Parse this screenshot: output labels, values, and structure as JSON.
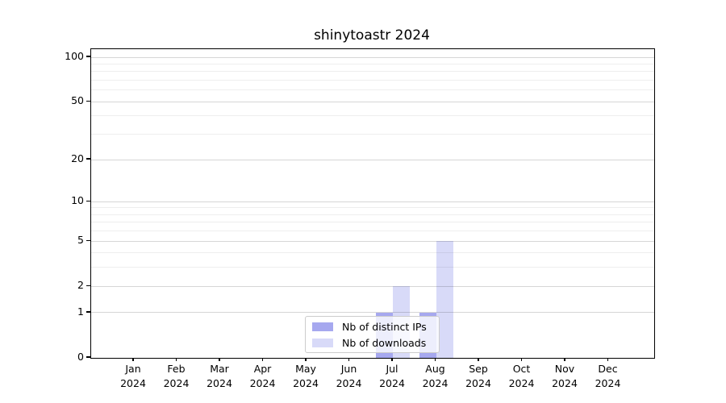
{
  "chart_data": {
    "type": "bar",
    "title": "shinytoastr 2024",
    "categories": [
      "Jan",
      "Feb",
      "Mar",
      "Apr",
      "May",
      "Jun",
      "Jul",
      "Aug",
      "Sep",
      "Oct",
      "Nov",
      "Dec"
    ],
    "year_label": "2024",
    "series": [
      {
        "name": "Nb of distinct IPs",
        "color": "#a6a8ef",
        "values": [
          0,
          0,
          0,
          0,
          0,
          0,
          1,
          1,
          0,
          0,
          0,
          0
        ]
      },
      {
        "name": "Nb of downloads",
        "color": "#d8daf8",
        "values": [
          0,
          0,
          0,
          0,
          0,
          0,
          2,
          5,
          0,
          0,
          0,
          0
        ]
      }
    ],
    "xlabel": "",
    "ylabel": "",
    "yscale": "log1p",
    "ylim": [
      0,
      113
    ],
    "yticks_major": [
      0,
      1,
      2,
      5,
      10,
      20,
      50,
      100
    ],
    "yticks_minor": [
      3,
      4,
      6,
      7,
      8,
      9,
      30,
      40,
      60,
      70,
      80,
      90
    ],
    "grid": true,
    "legend_position": "lower center"
  }
}
